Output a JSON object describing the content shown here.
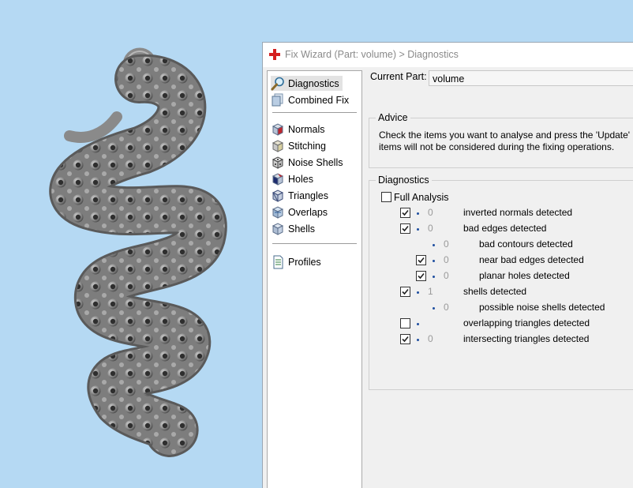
{
  "window": {
    "title": "Fix Wizard (Part: volume) > Diagnostics"
  },
  "nav": {
    "items": [
      {
        "label": "Diagnostics",
        "icon": "magnifier-icon"
      },
      {
        "label": "Combined Fix",
        "icon": "combined-fix-icon"
      },
      {
        "label": "Normals",
        "icon": "normals-cube-icon"
      },
      {
        "label": "Stitching",
        "icon": "stitching-cube-icon"
      },
      {
        "label": "Noise Shells",
        "icon": "noise-shells-dice-icon"
      },
      {
        "label": "Holes",
        "icon": "holes-cube-icon"
      },
      {
        "label": "Triangles",
        "icon": "triangles-cube-icon"
      },
      {
        "label": "Overlaps",
        "icon": "overlaps-cube-icon"
      },
      {
        "label": "Shells",
        "icon": "shells-cube-icon"
      },
      {
        "label": "Profiles",
        "icon": "profiles-document-icon"
      }
    ],
    "selected": "Diagnostics"
  },
  "current_part": {
    "label": "Current Part:",
    "value": "volume"
  },
  "advice": {
    "title": "Advice",
    "line1": "Check the items you want to analyse and press the 'Update' b",
    "line2": "items will not be considered during the fixing operations."
  },
  "diagnostics": {
    "title": "Diagnostics",
    "full_analysis_label": "Full Analysis",
    "full_analysis_checked": false,
    "rows": [
      {
        "checked": true,
        "has_checkbox": true,
        "count": "0",
        "label": "inverted normals detected"
      },
      {
        "checked": true,
        "has_checkbox": true,
        "count": "0",
        "label": "bad edges detected"
      },
      {
        "checked": false,
        "has_checkbox": false,
        "count": "0",
        "label": "bad contours detected"
      },
      {
        "checked": true,
        "has_checkbox": true,
        "count": "0",
        "label": "near bad edges detected"
      },
      {
        "checked": true,
        "has_checkbox": true,
        "count": "0",
        "label": "planar holes detected"
      },
      {
        "checked": true,
        "has_checkbox": true,
        "count": "1",
        "label": "shells detected"
      },
      {
        "checked": false,
        "has_checkbox": false,
        "count": "0",
        "label": "possible noise shells detected"
      },
      {
        "checked": false,
        "has_checkbox": true,
        "count": "",
        "label": "overlapping triangles detected"
      },
      {
        "checked": true,
        "has_checkbox": true,
        "count": "0",
        "label": "intersecting triangles detected"
      }
    ]
  },
  "colors": {
    "viewport_background": "#b5d9f3",
    "model": "#8c8c8c",
    "title_icon": "#d42020",
    "bullet": "#1f4fa0"
  }
}
